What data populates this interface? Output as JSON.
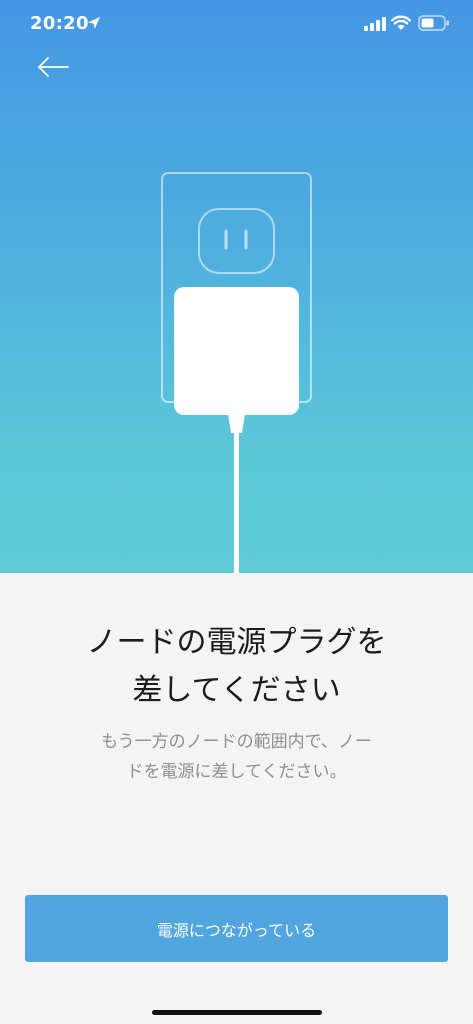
{
  "status_bar": {
    "time": "20:20",
    "icons": [
      "location-arrow-icon",
      "cellular-signal-icon",
      "wifi-icon",
      "battery-icon"
    ]
  },
  "header": {
    "back_icon": "arrow-left-icon"
  },
  "illustration": {
    "subject": "power-adapter-plugged-into-wall-outlet",
    "colors": {
      "gradient_top": "#4596e3",
      "gradient_bottom": "#5dcad6",
      "plug": "#ffffff"
    }
  },
  "main": {
    "title": "ノードの電源プラグを\n差してください",
    "description": "もう一方のノードの範囲内で、ノー\nドを電源に差してください。"
  },
  "actions": {
    "primary_label": "電源につながっている",
    "primary_color": "#52a6e0"
  }
}
